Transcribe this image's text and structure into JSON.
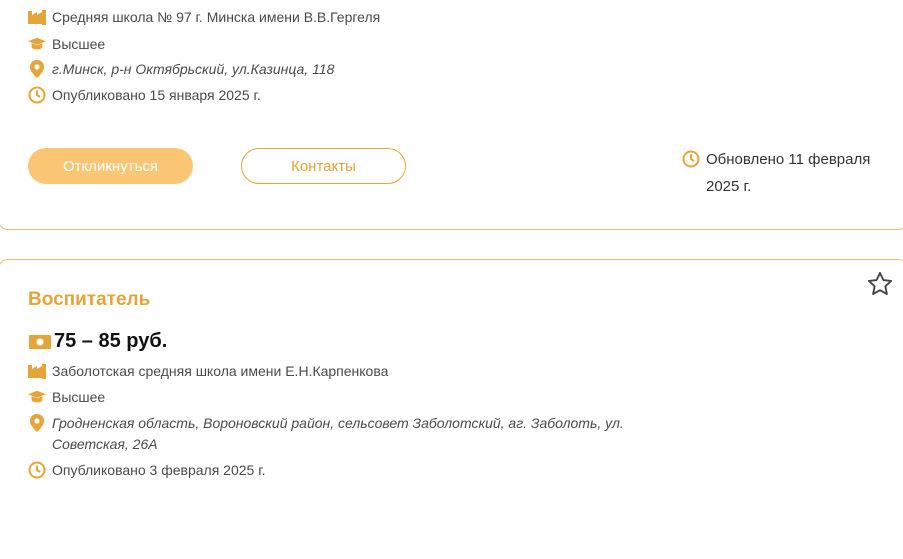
{
  "card1": {
    "school": "Средняя школа № 97 г. Минска имени В.В.Гергеля",
    "education": "Высшее",
    "address": "г.Минск, р-н Октябрьский, ул.Казинца, 118",
    "published": "Опубликовано 15 января 2025 г.",
    "apply_label": "Откликнуться",
    "contacts_label": "Контакты",
    "updated_line1": "Обновлено 11 февраля",
    "updated_line2": "2025 г."
  },
  "card2": {
    "title": "Воспитатель",
    "salary": "75 – 85 руб.",
    "school": "Заболотская средняя школа имени Е.Н.Карпенкова",
    "education": "Высшее",
    "address_line1": "Гродненская область, Вороновский район, сельсовет Заболотский, аг. Заболоть, ул.",
    "address_line2": "Советская, 26А",
    "published": "Опубликовано 3 февраля 2025 г."
  },
  "icons": {
    "building": "building-icon",
    "education": "graduation-cap-icon",
    "location": "location-pin-icon",
    "clock": "clock-icon",
    "money": "money-icon",
    "star": "star-outline-icon"
  },
  "colors": {
    "accent": "#e5a53a",
    "button_fill": "#fbc673",
    "border": "#e2c07a"
  }
}
